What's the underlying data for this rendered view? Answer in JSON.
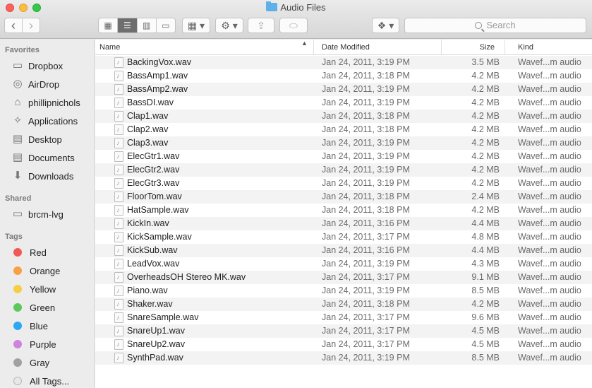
{
  "window": {
    "title": "Audio Files"
  },
  "toolbar": {
    "search_placeholder": "Search",
    "back_label": "‹",
    "forward_label": "›"
  },
  "sidebar": {
    "favorites_heading": "Favorites",
    "favorites": [
      {
        "label": "Dropbox",
        "icon": "folder-icon"
      },
      {
        "label": "AirDrop",
        "icon": "airdrop-icon"
      },
      {
        "label": "phillipnichols",
        "icon": "home-icon"
      },
      {
        "label": "Applications",
        "icon": "applications-icon"
      },
      {
        "label": "Desktop",
        "icon": "desktop-icon"
      },
      {
        "label": "Documents",
        "icon": "documents-icon"
      },
      {
        "label": "Downloads",
        "icon": "downloads-icon"
      }
    ],
    "shared_heading": "Shared",
    "shared": [
      {
        "label": "brcm-lvg",
        "icon": "computer-icon"
      }
    ],
    "tags_heading": "Tags",
    "tags": [
      {
        "label": "Red",
        "color": "#f25856"
      },
      {
        "label": "Orange",
        "color": "#f7a144"
      },
      {
        "label": "Yellow",
        "color": "#f6ce46"
      },
      {
        "label": "Green",
        "color": "#5bc85b"
      },
      {
        "label": "Blue",
        "color": "#2fa6f1"
      },
      {
        "label": "Purple",
        "color": "#cf82de"
      },
      {
        "label": "Gray",
        "color": "#a1a1a4"
      },
      {
        "label": "All Tags...",
        "color": "#e8e8e8"
      }
    ]
  },
  "columns": {
    "name": "Name",
    "date": "Date Modified",
    "size": "Size",
    "kind": "Kind"
  },
  "files": [
    {
      "name": "BackingVox.wav",
      "date": "Jan 24, 2011, 3:19 PM",
      "size": "3.5 MB",
      "kind": "Wavef...m audio"
    },
    {
      "name": "BassAmp1.wav",
      "date": "Jan 24, 2011, 3:18 PM",
      "size": "4.2 MB",
      "kind": "Wavef...m audio"
    },
    {
      "name": "BassAmp2.wav",
      "date": "Jan 24, 2011, 3:19 PM",
      "size": "4.2 MB",
      "kind": "Wavef...m audio"
    },
    {
      "name": "BassDI.wav",
      "date": "Jan 24, 2011, 3:19 PM",
      "size": "4.2 MB",
      "kind": "Wavef...m audio"
    },
    {
      "name": "Clap1.wav",
      "date": "Jan 24, 2011, 3:18 PM",
      "size": "4.2 MB",
      "kind": "Wavef...m audio"
    },
    {
      "name": "Clap2.wav",
      "date": "Jan 24, 2011, 3:18 PM",
      "size": "4.2 MB",
      "kind": "Wavef...m audio"
    },
    {
      "name": "Clap3.wav",
      "date": "Jan 24, 2011, 3:19 PM",
      "size": "4.2 MB",
      "kind": "Wavef...m audio"
    },
    {
      "name": "ElecGtr1.wav",
      "date": "Jan 24, 2011, 3:19 PM",
      "size": "4.2 MB",
      "kind": "Wavef...m audio"
    },
    {
      "name": "ElecGtr2.wav",
      "date": "Jan 24, 2011, 3:19 PM",
      "size": "4.2 MB",
      "kind": "Wavef...m audio"
    },
    {
      "name": "ElecGtr3.wav",
      "date": "Jan 24, 2011, 3:19 PM",
      "size": "4.2 MB",
      "kind": "Wavef...m audio"
    },
    {
      "name": "FloorTom.wav",
      "date": "Jan 24, 2011, 3:18 PM",
      "size": "2.4 MB",
      "kind": "Wavef...m audio"
    },
    {
      "name": "HatSample.wav",
      "date": "Jan 24, 2011, 3:18 PM",
      "size": "4.2 MB",
      "kind": "Wavef...m audio"
    },
    {
      "name": "KickIn.wav",
      "date": "Jan 24, 2011, 3:16 PM",
      "size": "4.4 MB",
      "kind": "Wavef...m audio"
    },
    {
      "name": "KickSample.wav",
      "date": "Jan 24, 2011, 3:17 PM",
      "size": "4.8 MB",
      "kind": "Wavef...m audio"
    },
    {
      "name": "KickSub.wav",
      "date": "Jan 24, 2011, 3:16 PM",
      "size": "4.4 MB",
      "kind": "Wavef...m audio"
    },
    {
      "name": "LeadVox.wav",
      "date": "Jan 24, 2011, 3:19 PM",
      "size": "4.3 MB",
      "kind": "Wavef...m audio"
    },
    {
      "name": "OverheadsOH Stereo MK.wav",
      "date": "Jan 24, 2011, 3:17 PM",
      "size": "9.1 MB",
      "kind": "Wavef...m audio"
    },
    {
      "name": "Piano.wav",
      "date": "Jan 24, 2011, 3:19 PM",
      "size": "8.5 MB",
      "kind": "Wavef...m audio"
    },
    {
      "name": "Shaker.wav",
      "date": "Jan 24, 2011, 3:18 PM",
      "size": "4.2 MB",
      "kind": "Wavef...m audio"
    },
    {
      "name": "SnareSample.wav",
      "date": "Jan 24, 2011, 3:17 PM",
      "size": "9.6 MB",
      "kind": "Wavef...m audio"
    },
    {
      "name": "SnareUp1.wav",
      "date": "Jan 24, 2011, 3:17 PM",
      "size": "4.5 MB",
      "kind": "Wavef...m audio"
    },
    {
      "name": "SnareUp2.wav",
      "date": "Jan 24, 2011, 3:17 PM",
      "size": "4.5 MB",
      "kind": "Wavef...m audio"
    },
    {
      "name": "SynthPad.wav",
      "date": "Jan 24, 2011, 3:19 PM",
      "size": "8.5 MB",
      "kind": "Wavef...m audio"
    }
  ]
}
